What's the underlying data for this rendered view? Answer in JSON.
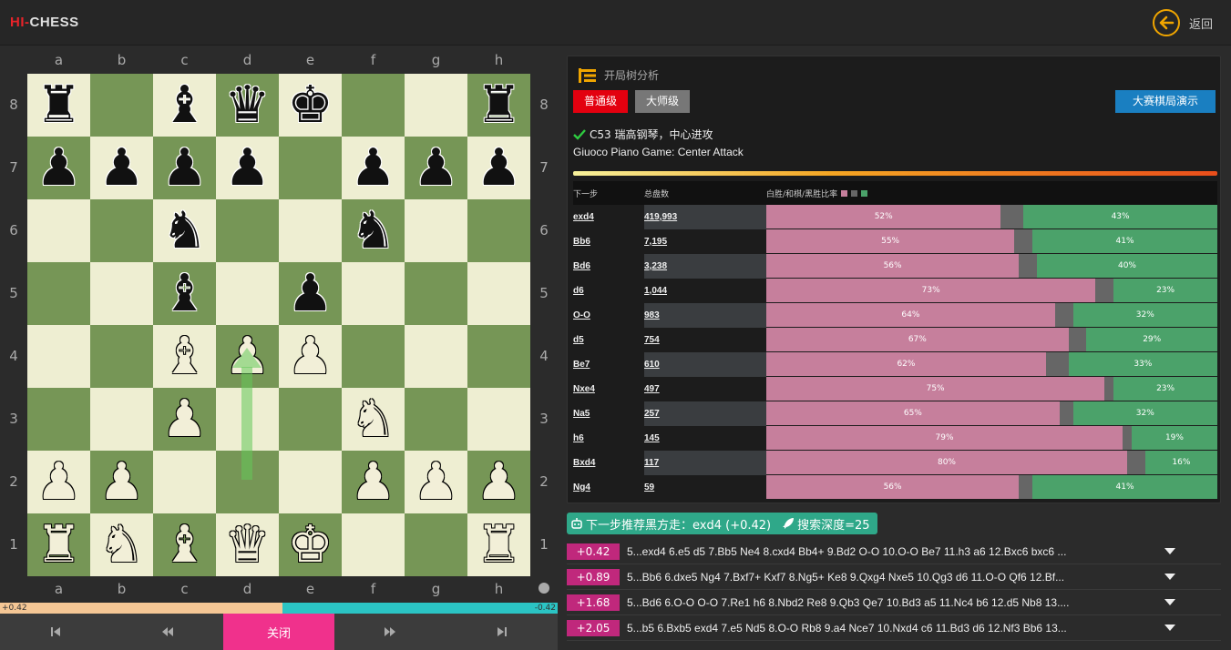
{
  "app": {
    "logo_red": "HI-",
    "logo_rest": "CHESS",
    "back_label": "返回"
  },
  "board": {
    "files": [
      "a",
      "b",
      "c",
      "d",
      "e",
      "f",
      "g",
      "h"
    ],
    "ranks": [
      "8",
      "7",
      "6",
      "5",
      "4",
      "3",
      "2",
      "1"
    ],
    "position": [
      [
        "bR",
        "",
        "bB",
        "bQ",
        "bK",
        "",
        "",
        "bR"
      ],
      [
        "bP",
        "bP",
        "bP",
        "bP",
        "",
        "bP",
        "bP",
        "bP"
      ],
      [
        "",
        "",
        "bN",
        "",
        "",
        "bN",
        "",
        ""
      ],
      [
        "",
        "",
        "bB",
        "",
        "bP",
        "",
        "",
        ""
      ],
      [
        "",
        "",
        "wB",
        "wP",
        "wP",
        "",
        "",
        ""
      ],
      [
        "",
        "",
        "wP",
        "",
        "",
        "wN",
        "",
        ""
      ],
      [
        "wP",
        "wP",
        "",
        "",
        "",
        "wP",
        "wP",
        "wP"
      ],
      [
        "wR",
        "wN",
        "wB",
        "wQ",
        "wK",
        "",
        "",
        "wR"
      ]
    ],
    "arrow": {
      "from": "d2",
      "to": "d4",
      "color": "#64c85a"
    }
  },
  "eval": {
    "white_label": "+0.42",
    "black_label": "-0.42",
    "white_fraction": 0.507
  },
  "controls": {
    "first": "first",
    "prev": "prev",
    "close_label": "关闭",
    "next": "next",
    "last": "last"
  },
  "analysis": {
    "title": "开局树分析",
    "btn_normal": "普通级",
    "btn_master": "大师级",
    "btn_demo": "大赛棋局演示",
    "opening_code": "C53 瑞高钢琴，中心进攻",
    "opening_name": "Giuoco Piano Game: Center Attack",
    "table": {
      "col_move": "下一步",
      "col_total": "总盘数",
      "col_ratio": "白胜/和棋/黑胜比率",
      "colors": {
        "white_win": "#c67f9c",
        "draw": "#666666",
        "black_win": "#4ba26a"
      },
      "rows": [
        {
          "move": "exd4",
          "total": "419,993",
          "white": 52,
          "white_label": "52%",
          "black": 43,
          "black_label": "43%"
        },
        {
          "move": "Bb6",
          "total": "7,195",
          "white": 55,
          "white_label": "55%",
          "black": 41,
          "black_label": "41%"
        },
        {
          "move": "Bd6",
          "total": "3,238",
          "white": 56,
          "white_label": "56%",
          "black": 40,
          "black_label": "40%"
        },
        {
          "move": "d6",
          "total": "1,044",
          "white": 73,
          "white_label": "73%",
          "black": 23,
          "black_label": "23%"
        },
        {
          "move": "O-O",
          "total": "983",
          "white": 64,
          "white_label": "64%",
          "black": 32,
          "black_label": "32%"
        },
        {
          "move": "d5",
          "total": "754",
          "white": 67,
          "white_label": "67%",
          "black": 29,
          "black_label": "29%"
        },
        {
          "move": "Be7",
          "total": "610",
          "white": 62,
          "white_label": "62%",
          "black": 33,
          "black_label": "33%"
        },
        {
          "move": "Nxe4",
          "total": "497",
          "white": 75,
          "white_label": "75%",
          "black": 23,
          "black_label": "23%"
        },
        {
          "move": "Na5",
          "total": "257",
          "white": 65,
          "white_label": "65%",
          "black": 32,
          "black_label": "32%"
        },
        {
          "move": "h6",
          "total": "145",
          "white": 79,
          "white_label": "79%",
          "black": 19,
          "black_label": "19%"
        },
        {
          "move": "Bxd4",
          "total": "117",
          "white": 80,
          "white_label": "80%",
          "black": 16,
          "black_label": "16%"
        },
        {
          "move": "Ng4",
          "total": "59",
          "white": 56,
          "white_label": "56%",
          "black": 41,
          "black_label": "41%"
        }
      ]
    }
  },
  "engine": {
    "recommend": "下一步推荐黑方走：exd4 (+0.42)",
    "depth": "搜索深度=25",
    "lines": [
      {
        "score": "+0.42",
        "line": "5...exd4 6.e5 d5 7.Bb5 Ne4 8.cxd4 Bb4+ 9.Bd2 O-O 10.O-O Be7 11.h3 a6 12.Bxc6 bxc6 ..."
      },
      {
        "score": "+0.89",
        "line": "5...Bb6 6.dxe5 Ng4 7.Bxf7+ Kxf7 8.Ng5+ Ke8 9.Qxg4 Nxe5 10.Qg3 d6 11.O-O Qf6 12.Bf..."
      },
      {
        "score": "+1.68",
        "line": "5...Bd6 6.O-O O-O 7.Re1 h6 8.Nbd2 Re8 9.Qb3 Qe7 10.Bd3 a5 11.Nc4 b6 12.d5 Nb8 13...."
      },
      {
        "score": "+2.05",
        "line": "5...b5 6.Bxb5 exd4 7.e5 Nd5 8.O-O Rb8 9.a4 Nce7 10.Nxd4 c6 11.Bd3 d6 12.Nf3 Bb6 13..."
      }
    ]
  }
}
